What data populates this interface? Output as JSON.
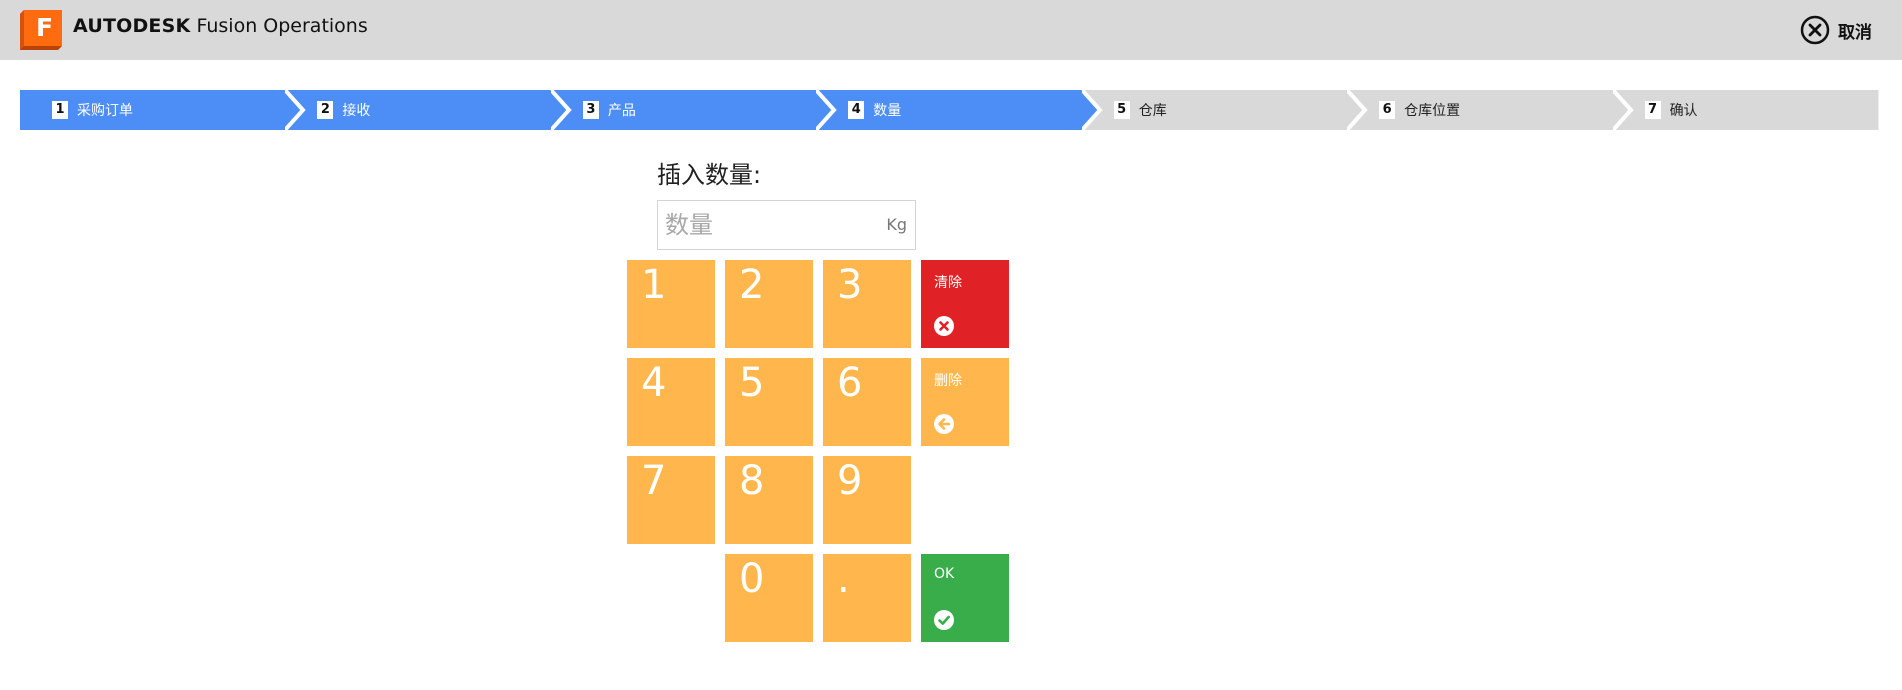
{
  "header": {
    "brand_bold": "AUTODESK",
    "brand_rest": "Fusion Operations",
    "logo_letter": "F",
    "cancel_label": "取消",
    "cancel_icon": "close-circle-icon"
  },
  "colors": {
    "step_active": "#4c8ef5",
    "step_inactive": "#d9d9d9",
    "key": "#ffb74d",
    "clear": "#e02226",
    "ok": "#38ad4a"
  },
  "steps": [
    {
      "num": "1",
      "label": "采购订单",
      "active": true
    },
    {
      "num": "2",
      "label": "接收",
      "active": true
    },
    {
      "num": "3",
      "label": "产品",
      "active": true
    },
    {
      "num": "4",
      "label": "数量",
      "active": true
    },
    {
      "num": "5",
      "label": "仓库",
      "active": false
    },
    {
      "num": "6",
      "label": "仓库位置",
      "active": false
    },
    {
      "num": "7",
      "label": "确认",
      "active": false
    }
  ],
  "quantity": {
    "prompt": "插入数量:",
    "placeholder": "数量",
    "value": "",
    "unit": "Kg"
  },
  "keypad": {
    "digits": [
      "1",
      "2",
      "3",
      "4",
      "5",
      "6",
      "7",
      "8",
      "9",
      "0",
      "."
    ],
    "clear_label": "清除",
    "clear_icon": "x-circle-icon",
    "delete_label": "删除",
    "delete_icon": "arrow-left-circle-icon",
    "ok_label": "OK",
    "ok_icon": "check-circle-icon"
  }
}
